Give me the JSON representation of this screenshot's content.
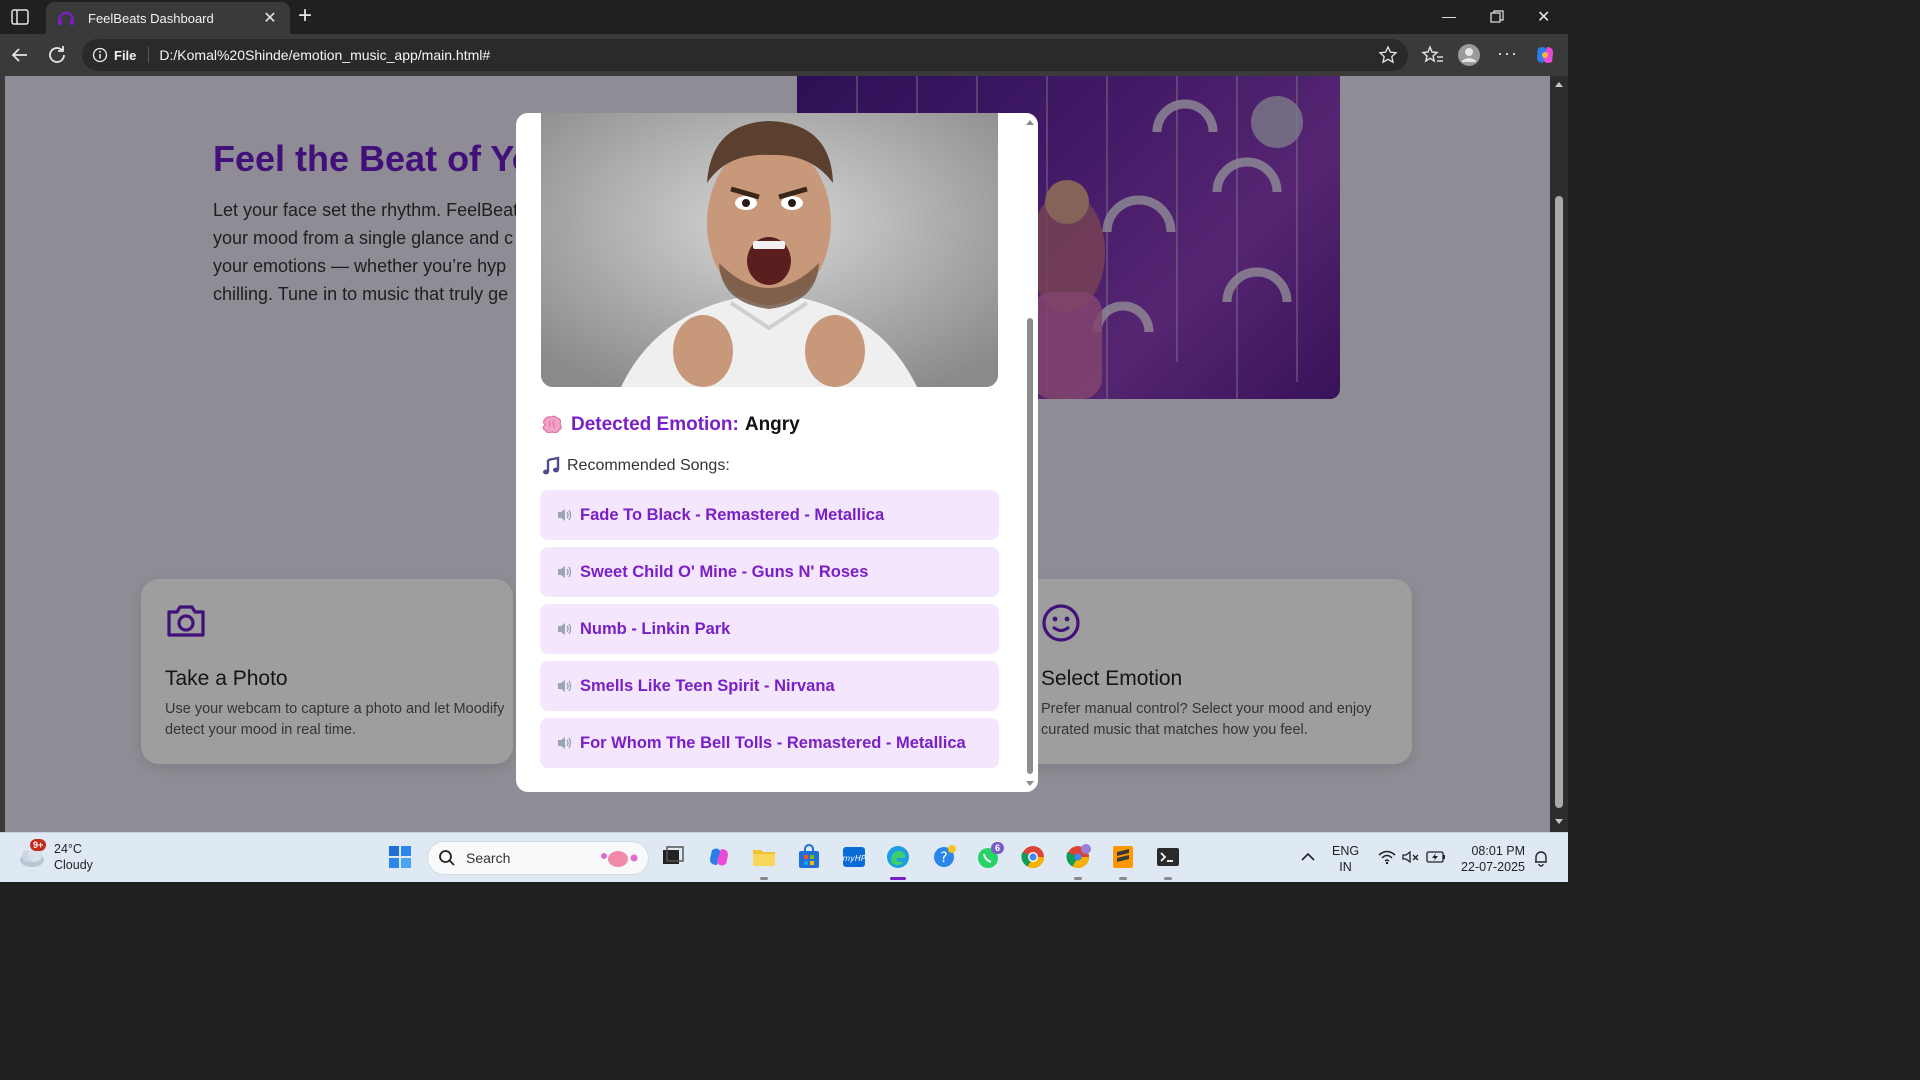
{
  "browser": {
    "tab_title": "FeelBeats Dashboard",
    "file_chip": "File",
    "url": "D:/Komal%20Shinde/emotion_music_app/main.html#"
  },
  "hero": {
    "title": "Feel the Beat of Yo",
    "lines": [
      "Let your face set the rhythm. FeelBeat",
      "your mood from a single glance and c",
      "your emotions — whether you’re hyp",
      "chilling. Tune in to music that truly ge"
    ]
  },
  "cards": {
    "photo": {
      "title": "Take a Photo",
      "text": "Use your webcam to capture a photo and let Moodify detect your mood in real time."
    },
    "emotion": {
      "title": "Select Emotion",
      "text": "Prefer manual control? Select your mood and enjoy curated music that matches how you feel."
    }
  },
  "modal": {
    "detected_label": "Detected Emotion:",
    "detected_value": "Angry",
    "recommended_label": "Recommended Songs:",
    "songs": [
      "Fade To Black - Remastered - Metallica",
      "Sweet Child O' Mine - Guns N' Roses",
      "Numb - Linkin Park",
      "Smells Like Teen Spirit - Nirvana",
      "For Whom The Bell Tolls - Remastered - Metallica"
    ]
  },
  "taskbar": {
    "weather_temp": "24°C",
    "weather_desc": "Cloudy",
    "weather_badge": "9+",
    "search_placeholder": "Search",
    "whatsapp_badge": "6",
    "lang_1": "ENG",
    "lang_2": "IN",
    "time": "08:01 PM",
    "date": "22-07-2025"
  },
  "colors": {
    "accent": "#7a1fc6",
    "song_bg": "#f3e6fd"
  }
}
